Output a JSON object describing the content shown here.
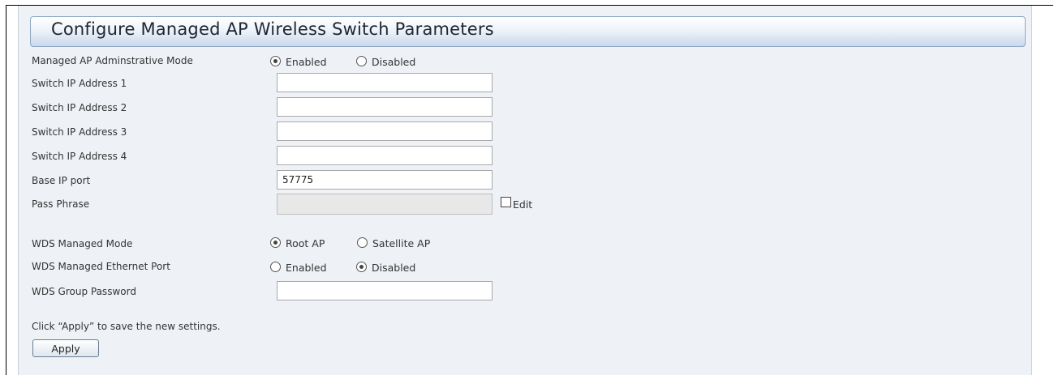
{
  "panel": {
    "title": "Configure Managed AP Wireless Switch Parameters"
  },
  "fields": {
    "admin_mode": {
      "label": "Managed AP Adminstrative Mode",
      "options": [
        "Enabled",
        "Disabled"
      ],
      "selected": "Enabled"
    },
    "switch_ip_1": {
      "label": "Switch IP Address 1",
      "value": ""
    },
    "switch_ip_2": {
      "label": "Switch IP Address 2",
      "value": ""
    },
    "switch_ip_3": {
      "label": "Switch IP Address 3",
      "value": ""
    },
    "switch_ip_4": {
      "label": "Switch IP Address 4",
      "value": ""
    },
    "base_ip_port": {
      "label": "Base IP port",
      "value": "57775"
    },
    "pass_phrase": {
      "label": "Pass Phrase",
      "value": "",
      "edit_label": "Edit",
      "edit_checked": false
    },
    "wds_managed_mode": {
      "label": "WDS Managed Mode",
      "options": [
        "Root AP",
        "Satellite AP"
      ],
      "selected": "Root AP"
    },
    "wds_ethernet_port": {
      "label": "WDS Managed Ethernet Port",
      "options": [
        "Enabled",
        "Disabled"
      ],
      "selected": "Disabled"
    },
    "wds_group_password": {
      "label": "WDS Group Password",
      "value": ""
    }
  },
  "footer": {
    "note": "Click “Apply” to save the new settings.",
    "apply_label": "Apply"
  }
}
